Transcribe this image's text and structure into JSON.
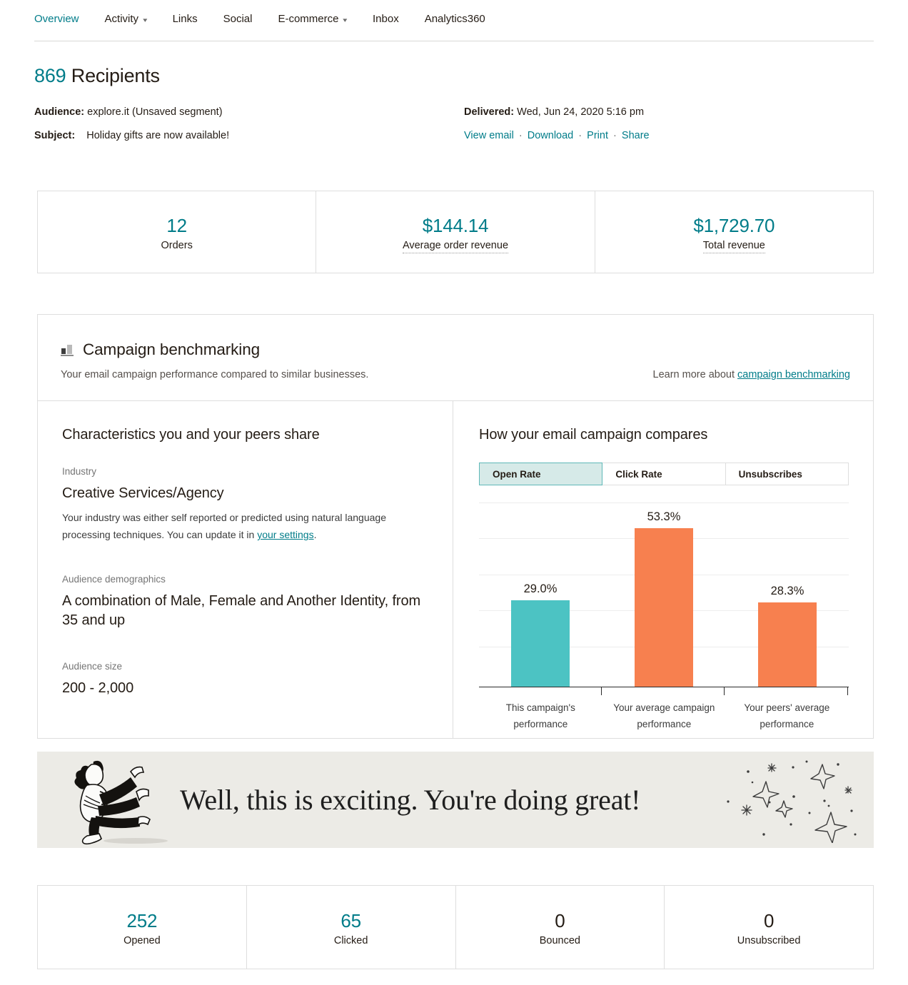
{
  "nav": {
    "items": [
      {
        "label": "Overview",
        "active": true,
        "caret": false
      },
      {
        "label": "Activity",
        "active": false,
        "caret": true
      },
      {
        "label": "Links",
        "active": false,
        "caret": false
      },
      {
        "label": "Social",
        "active": false,
        "caret": false
      },
      {
        "label": "E-commerce",
        "active": false,
        "caret": true
      },
      {
        "label": "Inbox",
        "active": false,
        "caret": false
      },
      {
        "label": "Analytics360",
        "active": false,
        "caret": false
      }
    ]
  },
  "header": {
    "recipients_count": "869",
    "recipients_word": "Recipients",
    "audience_label": "Audience:",
    "audience_value": "explore.it (Unsaved segment)",
    "subject_label": "Subject:",
    "subject_value": "Holiday gifts are now available!",
    "delivered_label": "Delivered:",
    "delivered_value": "Wed, Jun 24, 2020 5:16 pm",
    "actions": [
      "View email",
      "Download",
      "Print",
      "Share"
    ],
    "action_separator": "·"
  },
  "ecommerce_stats": [
    {
      "value": "12",
      "label": "Orders",
      "dotted": false
    },
    {
      "value": "$144.14",
      "label": "Average order revenue",
      "dotted": true
    },
    {
      "value": "$1,729.70",
      "label": "Total revenue",
      "dotted": true
    }
  ],
  "benchmarking": {
    "icon": "bar-chart-icon",
    "title": "Campaign benchmarking",
    "subtitle": "Your email campaign performance compared to similar businesses.",
    "learn_prefix": "Learn more about ",
    "learn_link": "campaign benchmarking",
    "left": {
      "title": "Characteristics you and your peers share",
      "industry_label": "Industry",
      "industry_value": "Creative Services/Agency",
      "industry_note_a": "Your industry was either self reported or predicted using natural language processing techniques. You can update it in ",
      "industry_note_link": "your settings",
      "industry_note_b": ".",
      "demographics_label": "Audience demographics",
      "demographics_value": "A combination of Male, Female and Another Identity, from 35 and up",
      "size_label": "Audience size",
      "size_value": "200 - 2,000"
    },
    "right": {
      "title": "How your email campaign compares",
      "tabs": [
        {
          "label": "Open Rate",
          "active": true
        },
        {
          "label": "Click Rate",
          "active": false
        },
        {
          "label": "Unsubscribes",
          "active": false
        }
      ]
    }
  },
  "chart_data": {
    "type": "bar",
    "title": "How your email campaign compares",
    "metric": "Open Rate",
    "categories": [
      "This campaign's performance",
      "Your average campaign performance",
      "Your peers' average performance"
    ],
    "values": [
      29.0,
      53.3,
      28.3
    ],
    "data_labels": [
      "29.0%",
      "53.3%",
      "28.3%"
    ],
    "colors": [
      "#4cc3c3",
      "#f7804f",
      "#f7804f"
    ],
    "xlabel": "",
    "ylabel": "",
    "ylim": [
      0,
      60
    ],
    "grid": true,
    "gridline_count": 5,
    "legend": "none",
    "axis_tick_labels_shown": false
  },
  "banner": {
    "text": "Well, this is exciting. You're doing great!",
    "background": "#ecebe6",
    "illustration": "running-person-illustration",
    "decoration": "sparkle-stars-illustration"
  },
  "engagement_stats": [
    {
      "value": "252",
      "label": "Opened",
      "accent": true
    },
    {
      "value": "65",
      "label": "Clicked",
      "accent": true
    },
    {
      "value": "0",
      "label": "Bounced",
      "accent": false
    },
    {
      "value": "0",
      "label": "Unsubscribed",
      "accent": false
    }
  ],
  "colors": {
    "accent_teal": "#007c89",
    "chart_teal": "#4cc3c3",
    "chart_orange": "#f7804f",
    "tab_active_bg": "#d6eae8",
    "tab_active_border": "#5fb8b8",
    "border": "#dedede",
    "banner_bg": "#ecebe6"
  }
}
